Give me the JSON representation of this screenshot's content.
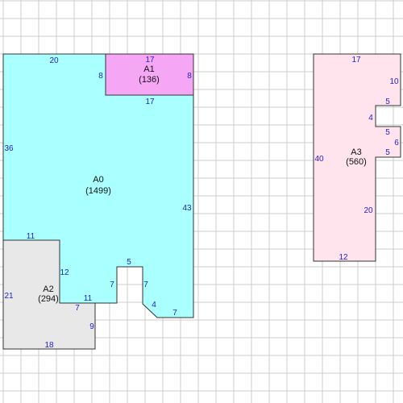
{
  "colors": {
    "grid": "#cccccc",
    "outline": "#333333",
    "dimension_text": "#1f1fd0",
    "label_text": "#111111",
    "A0": "#aaffff",
    "A1": "#f5a6f5",
    "A2": "#e8e8e8",
    "A3": "#ffe4ee"
  },
  "areas": {
    "A0": {
      "name": "A0",
      "value": "(1499)"
    },
    "A1": {
      "name": "A1",
      "value": "(136)"
    },
    "A2": {
      "name": "A2",
      "value": "(294)"
    },
    "A3": {
      "name": "A3",
      "value": "(560)"
    }
  },
  "dimensions": {
    "A0": {
      "top": "20",
      "left": "36",
      "right": "43",
      "inner_bottom": "17",
      "inner_left": "8",
      "step_right": "11",
      "step_left": "12",
      "notch_top": "5",
      "notch_left": "7",
      "notch_right": "7",
      "bevel": "4",
      "bottom": "7"
    },
    "A1": {
      "top": "17",
      "left": "8",
      "right": "8"
    },
    "A2": {
      "top": "11",
      "left": "21",
      "bottom": "18",
      "right": "9",
      "inner_right": "7"
    },
    "A3": {
      "top": "17",
      "left": "40",
      "right_top": "10",
      "notch_top": "5",
      "notch_left": "4",
      "notch_bottom": "5",
      "side": "6",
      "step": "5",
      "right_low": "20",
      "bottom": "12"
    }
  }
}
